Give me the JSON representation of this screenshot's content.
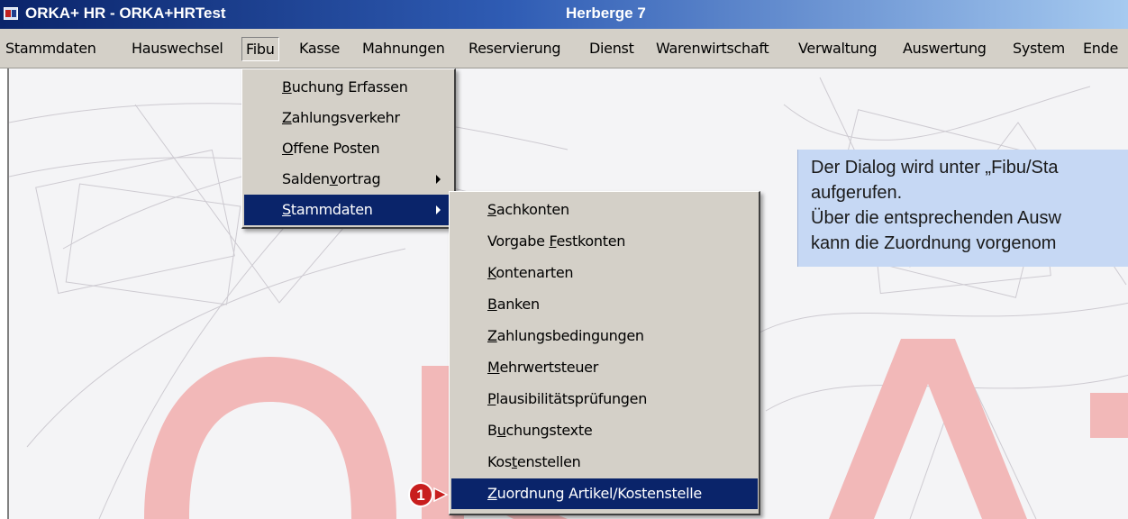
{
  "window": {
    "title_left": "ORKA+ HR  - ORKA+HRTest",
    "title_center": "Herberge 7"
  },
  "menubar": {
    "items": [
      "Stammdaten",
      "Hauswechsel",
      "Fibu",
      "Kasse",
      "Mahnungen",
      "Reservierung",
      "Dienst",
      "Warenwirtschaft",
      "Verwaltung",
      "Auswertung",
      "System",
      "Ende"
    ],
    "active": "Fibu"
  },
  "fibu_menu": {
    "items": [
      {
        "pre": "",
        "u": "B",
        "post": "uchung Erfassen"
      },
      {
        "pre": "",
        "u": "Z",
        "post": "ahlungsverkehr"
      },
      {
        "pre": "",
        "u": "O",
        "post": "ffene Posten"
      },
      {
        "pre": "Salden",
        "u": "v",
        "post": "ortrag"
      },
      {
        "pre": "",
        "u": "S",
        "post": "tammdaten"
      }
    ],
    "highlighted": "Stammdaten"
  },
  "stammdaten_menu": {
    "items": [
      {
        "pre": "",
        "u": "S",
        "post": "achkonten"
      },
      {
        "pre": "Vorgabe ",
        "u": "F",
        "post": "estkonten"
      },
      {
        "pre": "",
        "u": "K",
        "post": "ontenarten"
      },
      {
        "pre": "",
        "u": "B",
        "post": "anken"
      },
      {
        "pre": "",
        "u": "Z",
        "post": "ahlungsbedingungen"
      },
      {
        "pre": "",
        "u": "M",
        "post": "ehrwertsteuer"
      },
      {
        "pre": "",
        "u": "P",
        "post": "lausibilitätsprüfungen"
      },
      {
        "pre": "B",
        "u": "u",
        "post": "chungstexte"
      },
      {
        "pre": "Kos",
        "u": "t",
        "post": "enstellen"
      },
      {
        "pre": "",
        "u": "Z",
        "post": "uordnung Artikel/Kostenstelle"
      }
    ],
    "highlighted": "Zuordnung Artikel/Kostenstelle"
  },
  "callout": {
    "lines": [
      "Der Dialog wird unter „Fibu/Sta",
      "aufgerufen.",
      "Über die entsprechenden Ausw",
      "kann die Zuordnung vorgenom"
    ]
  },
  "marker": {
    "number": "1"
  },
  "background": {
    "watermark": "ORKA+"
  },
  "colors": {
    "highlight": "#0a246a",
    "menu_bg": "#d4d0c8",
    "callout_bg": "#c6d8f4",
    "marker": "#c81e1e",
    "watermark": "#f2b8b8"
  }
}
